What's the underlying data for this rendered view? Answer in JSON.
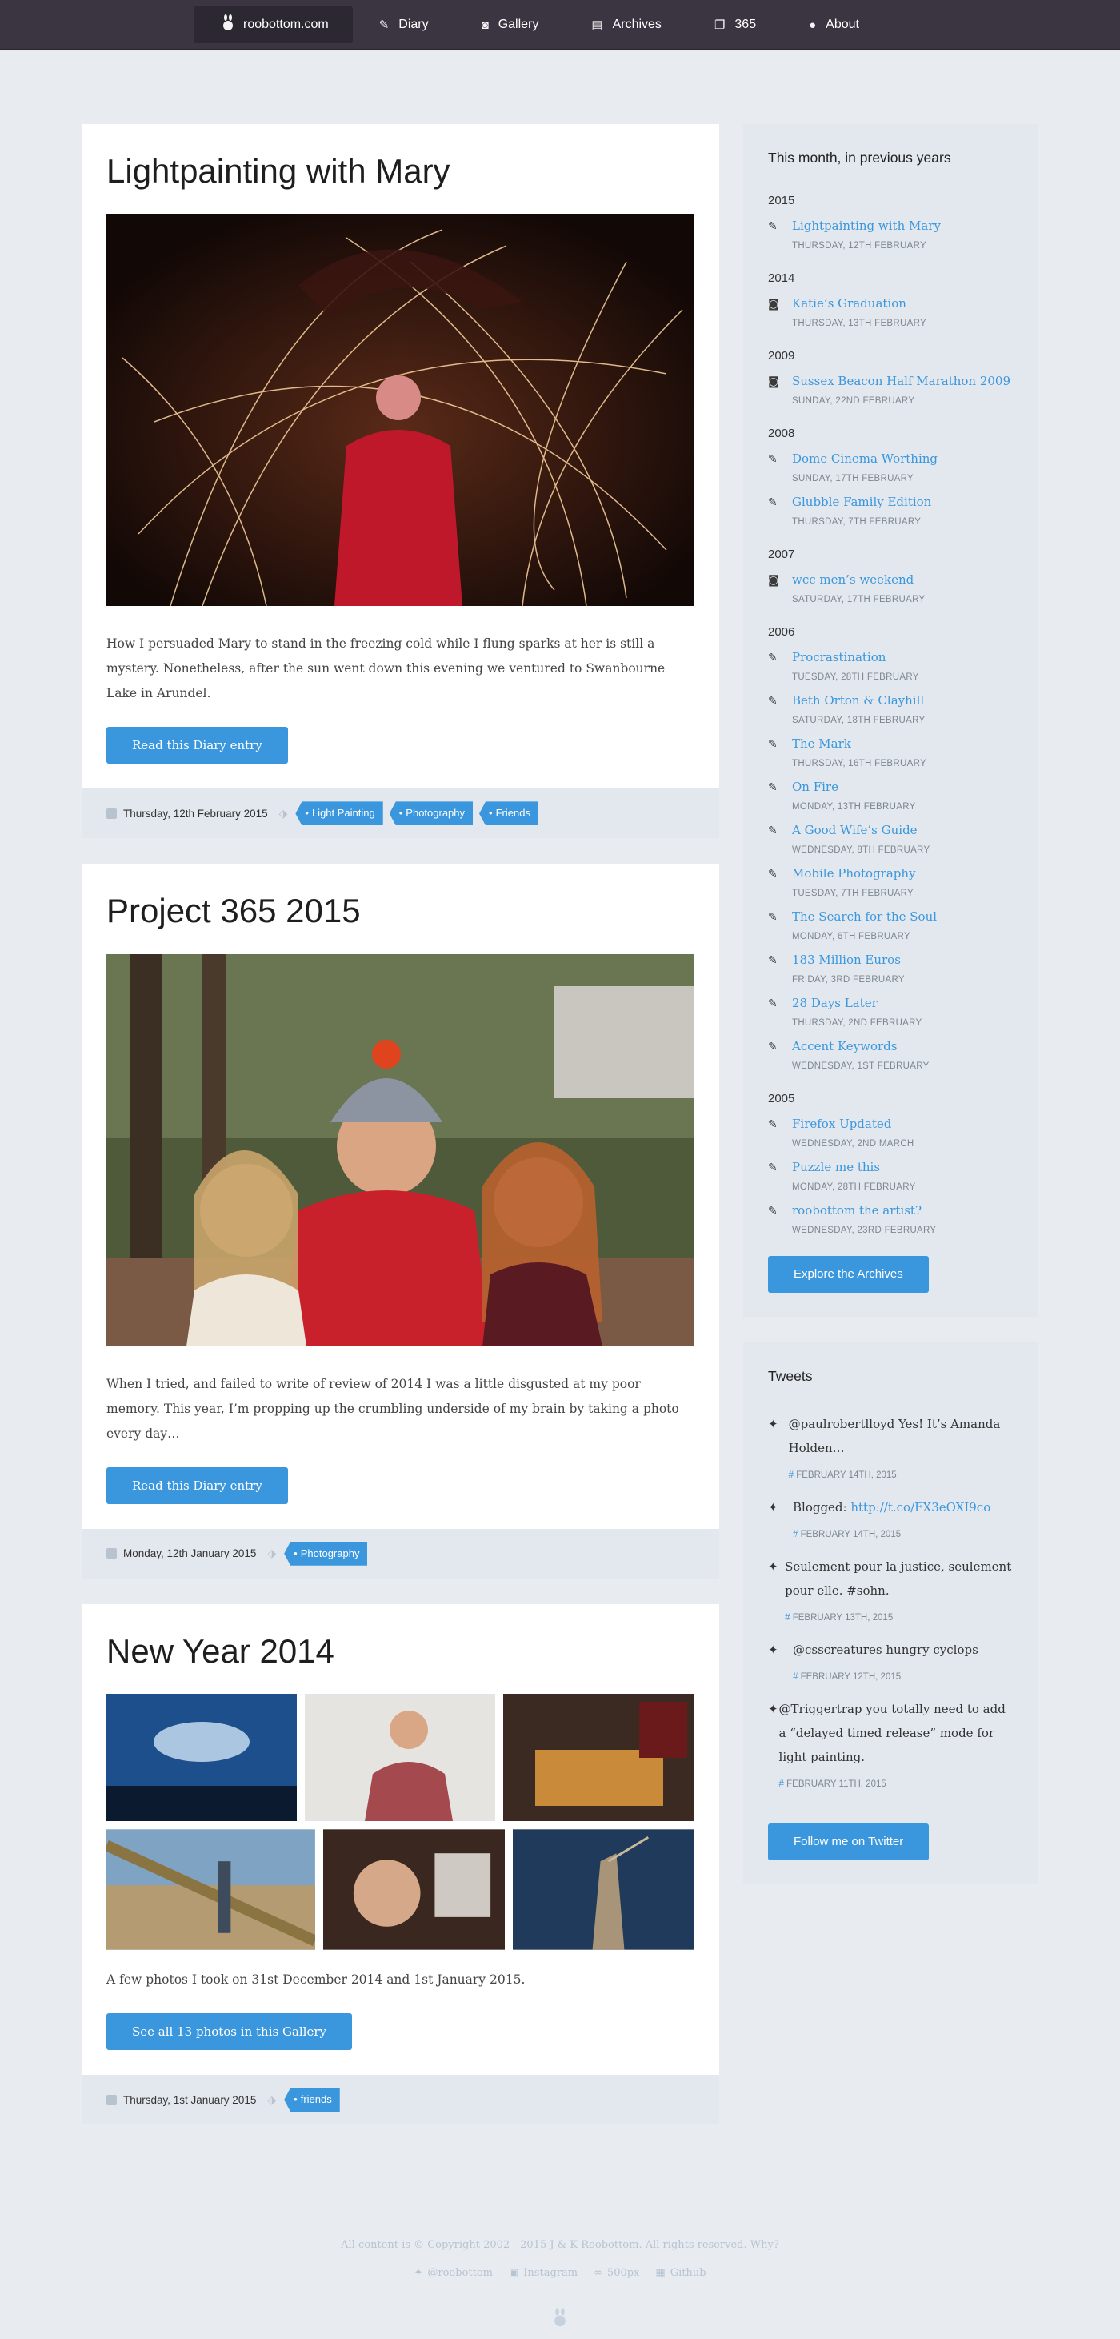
{
  "nav": {
    "home": "roobottom.com",
    "items": [
      {
        "label": "Diary",
        "icon": "pencil-icon"
      },
      {
        "label": "Gallery",
        "icon": "camera-icon"
      },
      {
        "label": "Archives",
        "icon": "archive-icon"
      },
      {
        "label": "365",
        "icon": "gallery-stack-icon"
      },
      {
        "label": "About",
        "icon": "user-icon"
      }
    ]
  },
  "posts": [
    {
      "title": "Lightpainting with Mary",
      "text": "How I persuaded Mary to stand in the freezing cold while I flung sparks at her is still a mystery. Nonetheless, after the sun went down this evening we ventured to Swanbourne Lake in Arundel.",
      "button": "Read this Diary entry",
      "date": "Thursday, 12th February 2015",
      "tags": [
        "Light Painting",
        "Photography",
        "Friends"
      ]
    },
    {
      "title": "Project 365 2015",
      "text": "When I tried, and failed to write of review of 2014 I was a little disgusted at my poor memory. This year, I’m propping up the crumbling underside of my brain by taking a photo every day…",
      "button": "Read this Diary entry",
      "date": "Monday, 12th January 2015",
      "tags": [
        "Photography"
      ]
    },
    {
      "title": "New Year 2014",
      "text": "A few photos I took on 31st December 2014 and 1st January 2015.",
      "button": "See all 13 photos in this Gallery",
      "date": "Thursday, 1st January 2015",
      "tags": [
        "friends"
      ]
    }
  ],
  "history": {
    "title": "This month, in previous years",
    "button": "Explore the Archives",
    "years": [
      {
        "year": "2015",
        "entries": [
          {
            "title": "Lightpainting with Mary",
            "date": "THURSDAY, 12TH FEBRUARY",
            "icon": "pencil-icon"
          }
        ]
      },
      {
        "year": "2014",
        "entries": [
          {
            "title": "Katie’s Graduation",
            "date": "THURSDAY, 13TH FEBRUARY",
            "icon": "camera-icon"
          }
        ]
      },
      {
        "year": "2009",
        "entries": [
          {
            "title": "Sussex Beacon Half Marathon 2009",
            "date": "SUNDAY, 22ND FEBRUARY",
            "icon": "camera-icon"
          }
        ]
      },
      {
        "year": "2008",
        "entries": [
          {
            "title": "Dome Cinema Worthing",
            "date": "SUNDAY, 17TH FEBRUARY",
            "icon": "pencil-icon"
          },
          {
            "title": "Glubble Family Edition",
            "date": "THURSDAY, 7TH FEBRUARY",
            "icon": "pencil-icon"
          }
        ]
      },
      {
        "year": "2007",
        "entries": [
          {
            "title": "wcc men’s weekend",
            "date": "SATURDAY, 17TH FEBRUARY",
            "icon": "camera-icon"
          }
        ]
      },
      {
        "year": "2006",
        "entries": [
          {
            "title": "Procrastination",
            "date": "TUESDAY, 28TH FEBRUARY",
            "icon": "pencil-icon"
          },
          {
            "title": "Beth Orton & Clayhill",
            "date": "SATURDAY, 18TH FEBRUARY",
            "icon": "pencil-icon"
          },
          {
            "title": "The Mark",
            "date": "THURSDAY, 16TH FEBRUARY",
            "icon": "pencil-icon"
          },
          {
            "title": "On Fire",
            "date": "MONDAY, 13TH FEBRUARY",
            "icon": "pencil-icon"
          },
          {
            "title": "A Good Wife’s Guide",
            "date": "WEDNESDAY, 8TH FEBRUARY",
            "icon": "pencil-icon"
          },
          {
            "title": "Mobile Photography",
            "date": "TUESDAY, 7TH FEBRUARY",
            "icon": "pencil-icon"
          },
          {
            "title": "The Search for the Soul",
            "date": "MONDAY, 6TH FEBRUARY",
            "icon": "pencil-icon"
          },
          {
            "title": "183 Million Euros",
            "date": "FRIDAY, 3RD FEBRUARY",
            "icon": "pencil-icon"
          },
          {
            "title": "28 Days Later",
            "date": "THURSDAY, 2ND FEBRUARY",
            "icon": "pencil-icon"
          },
          {
            "title": "Accent Keywords",
            "date": "WEDNESDAY, 1ST FEBRUARY",
            "icon": "pencil-icon"
          }
        ]
      },
      {
        "year": "2005",
        "entries": [
          {
            "title": "Firefox Updated",
            "date": "WEDNESDAY, 2ND MARCH",
            "icon": "pencil-icon"
          },
          {
            "title": "Puzzle me this",
            "date": "MONDAY, 28TH FEBRUARY",
            "icon": "pencil-icon"
          },
          {
            "title": "roobottom the artist?",
            "date": "WEDNESDAY, 23RD FEBRUARY",
            "icon": "pencil-icon"
          }
        ]
      }
    ]
  },
  "tweets": {
    "title": "Tweets",
    "button": "Follow me on Twitter",
    "items": [
      {
        "text": "@paulrobertlloyd Yes! It’s Amanda Holden…",
        "link": "",
        "date": "FEBRUARY 14TH, 2015"
      },
      {
        "text": "Blogged: ",
        "link": "http://t.co/FX3eOXI9co",
        "date": "FEBRUARY 14TH, 2015"
      },
      {
        "text": "Seulement pour la justice, seulement pour elle. #sohn.",
        "link": "",
        "date": "FEBRUARY 13TH, 2015"
      },
      {
        "text": "@csscreatures hungry cyclops",
        "link": "",
        "date": "FEBRUARY 12TH, 2015"
      },
      {
        "text": "@Triggertrap you totally need to add a “delayed timed release” mode for light painting.",
        "link": "",
        "date": "FEBRUARY 11TH, 2015"
      }
    ]
  },
  "footer": {
    "copyright": "All content is © Copyright 2002—2015 J & K Roobottom. All rights reserved.",
    "why": "Why?",
    "links": [
      {
        "label": "@roobottom",
        "icon": "twitter-icon"
      },
      {
        "label": "Instagram",
        "icon": "instagram-icon"
      },
      {
        "label": "500px",
        "icon": "500px-icon"
      },
      {
        "label": "Github",
        "icon": "github-icon"
      }
    ]
  }
}
